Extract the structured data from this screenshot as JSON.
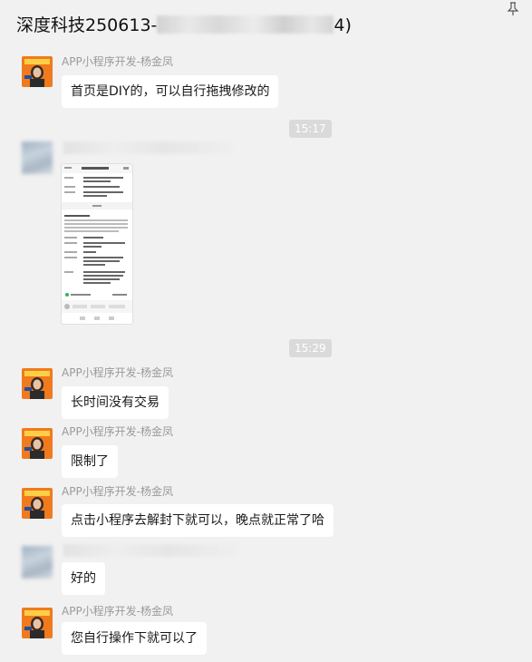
{
  "window": {
    "title_prefix": "深度科技250613-",
    "title_suffix": "4)",
    "pin_icon": "pin-icon"
  },
  "colors": {
    "chat_background": "#f1f1f1",
    "bubble": "#ffffff",
    "timestamp_background": "#dadada"
  },
  "messages": [
    {
      "sender": "APP小程序开发-杨金凤",
      "text": "首页是DIY的，可以自行拖拽修改的"
    },
    {
      "time": "15:17"
    },
    {
      "type": "image-screenshot"
    },
    {
      "time": "15:29"
    },
    {
      "sender": "APP小程序开发-杨金凤",
      "text": "长时间没有交易"
    },
    {
      "sender": "APP小程序开发-杨金凤",
      "text": "限制了"
    },
    {
      "sender": "APP小程序开发-杨金凤",
      "text": "点击小程序去解封下就可以，晚点就正常了哈"
    },
    {
      "sender": "",
      "text": "好的"
    },
    {
      "sender": "APP小程序开发-杨金凤",
      "text": "您自行操作下就可以了"
    }
  ]
}
